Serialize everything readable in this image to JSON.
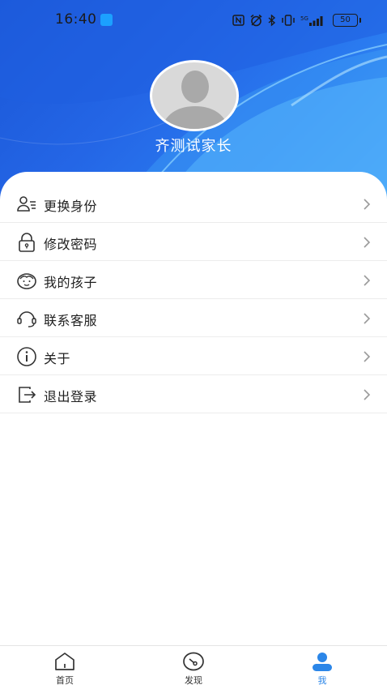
{
  "status_bar": {
    "time": "16:40",
    "battery": "50",
    "icons": [
      "nfc-icon",
      "alarm-icon",
      "bluetooth-icon",
      "vibrate-icon",
      "5g-signal-icon",
      "battery-icon"
    ]
  },
  "profile": {
    "username": "齐测试家长"
  },
  "menu": {
    "items": [
      {
        "label": "更换身份",
        "icon": "switch-identity-icon"
      },
      {
        "label": "修改密码",
        "icon": "lock-icon"
      },
      {
        "label": "我的孩子",
        "icon": "child-face-icon"
      },
      {
        "label": "联系客服",
        "icon": "headset-icon"
      },
      {
        "label": "关于",
        "icon": "info-icon"
      },
      {
        "label": "退出登录",
        "icon": "logout-icon"
      }
    ]
  },
  "tabbar": {
    "tabs": [
      {
        "label": "首页",
        "icon": "home-icon",
        "active": false
      },
      {
        "label": "发现",
        "icon": "discover-icon",
        "active": false
      },
      {
        "label": "我",
        "icon": "user-icon",
        "active": true
      }
    ]
  },
  "colors": {
    "header_blue": "#2466e6",
    "accent": "#2b86e8"
  }
}
